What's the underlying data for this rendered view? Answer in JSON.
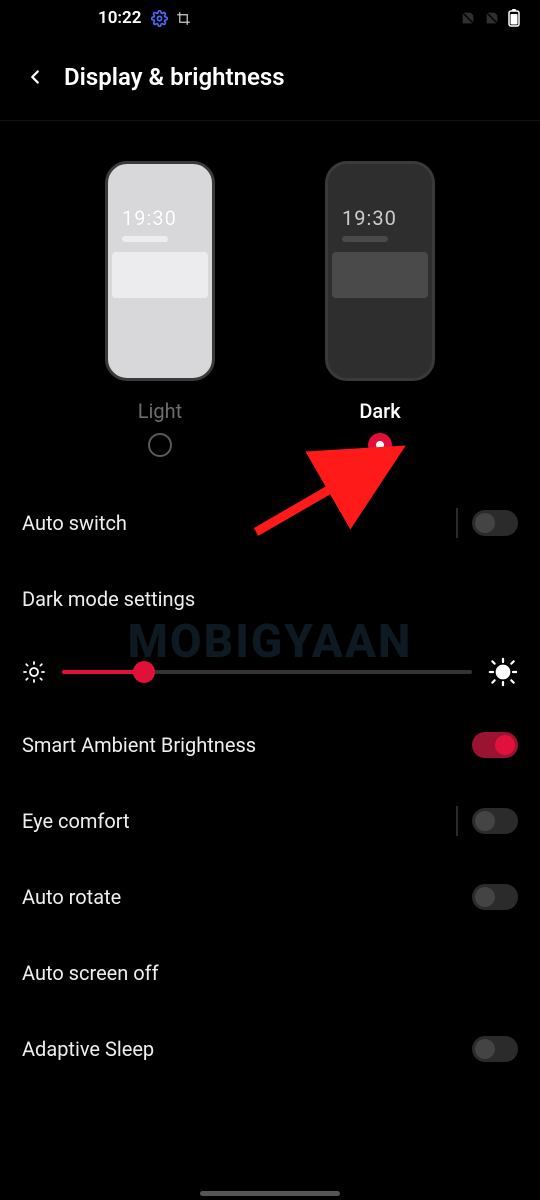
{
  "status": {
    "time": "10:22"
  },
  "header": {
    "title": "Display & brightness"
  },
  "themes": {
    "preview_time": "19:30",
    "light_label": "Light",
    "dark_label": "Dark",
    "selected": "dark"
  },
  "rows": {
    "auto_switch": "Auto switch",
    "dark_mode_settings": "Dark mode settings",
    "smart_ambient": "Smart Ambient Brightness",
    "eye_comfort": "Eye comfort",
    "auto_rotate": "Auto rotate",
    "auto_screen_off": "Auto screen off",
    "adaptive_sleep": "Adaptive Sleep"
  },
  "toggles": {
    "auto_switch": false,
    "smart_ambient": true,
    "eye_comfort": false,
    "auto_rotate": false,
    "adaptive_sleep": false
  },
  "brightness": {
    "percent": 20
  },
  "watermark": "MOBIGYAAN",
  "colors": {
    "accent": "#e1103a"
  }
}
